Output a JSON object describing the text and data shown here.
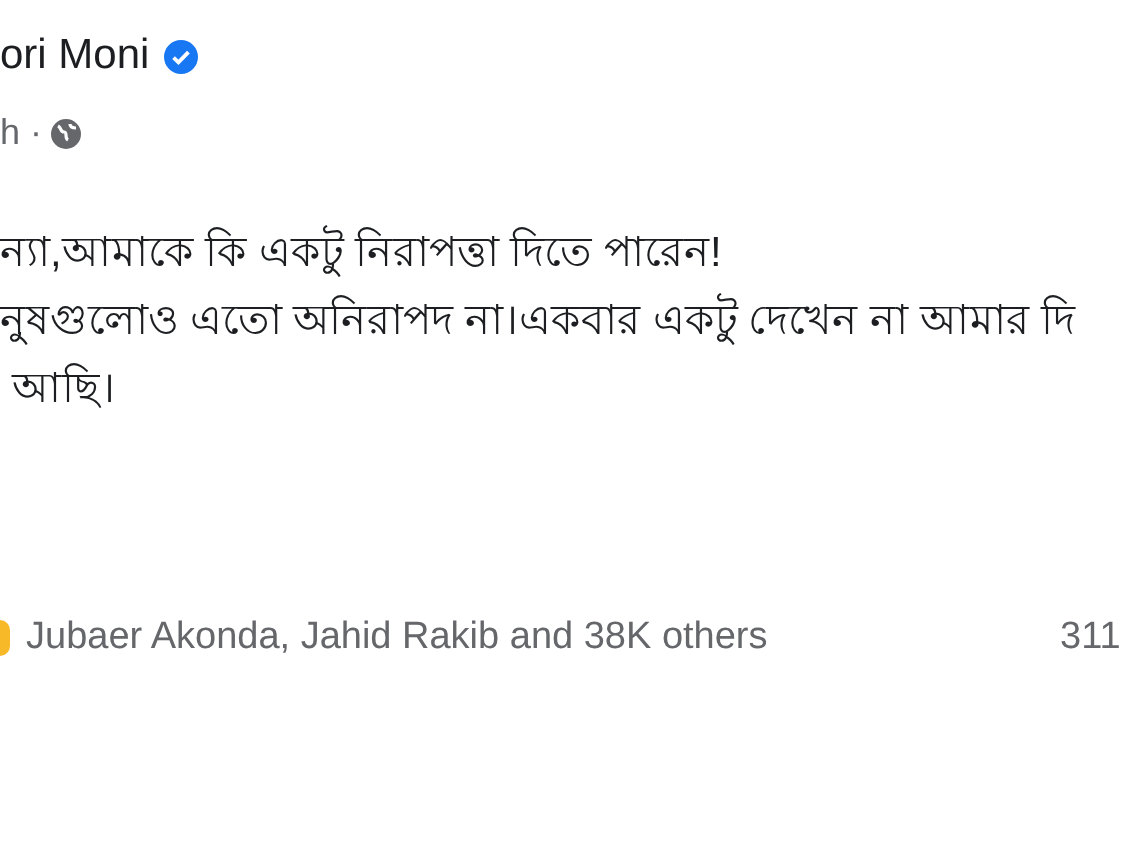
{
  "post": {
    "author": "ori Moni",
    "verified": true,
    "time": "h ·",
    "lines": [
      "ন্যা,আমাকে কি একটু নিরাপত্তা দিতে পারেন!",
      "নুষগুলোও এতো অনিরাপদ না।একবার একটু দেখেন না আমার দি",
      " আছি।"
    ],
    "reactions": {
      "summary": "Jubaer Akonda, Jahid Rakib and 38K others",
      "comments": "311"
    }
  }
}
